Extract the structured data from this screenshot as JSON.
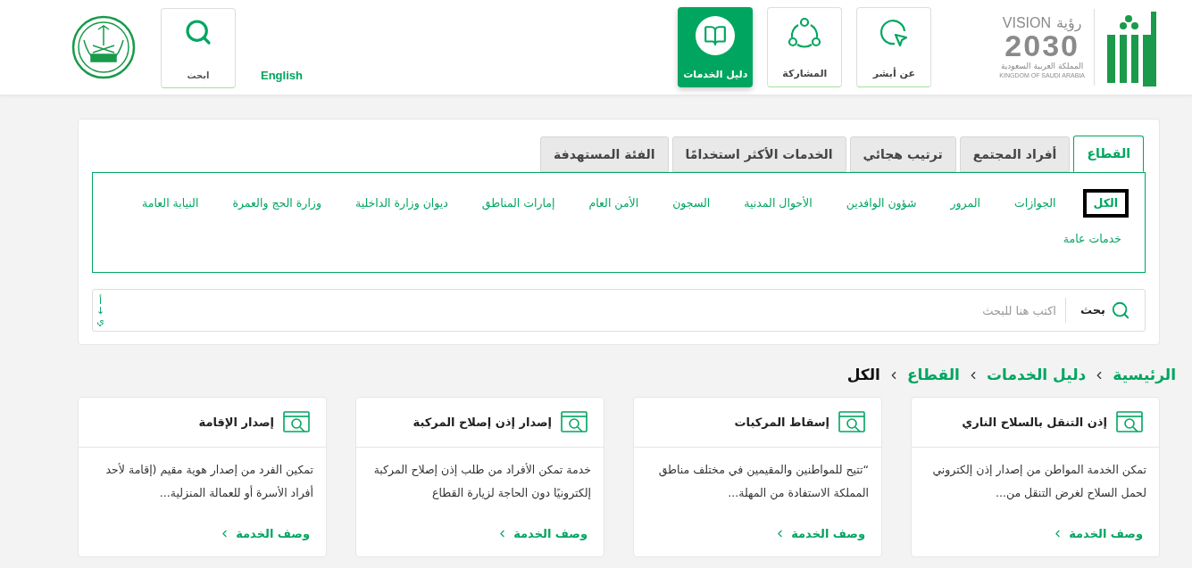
{
  "header": {
    "logo": {
      "vision": "VISION",
      "vision_ar": "رؤية",
      "year": "2030",
      "country_ar": "المملكة العربية السعودية",
      "country_en": "KINGDOM OF SAUDI ARABIA"
    },
    "nav": [
      {
        "label": "عن أبشر",
        "selected": false,
        "kind": "pointer"
      },
      {
        "label": "المشاركة",
        "selected": false,
        "kind": "share"
      },
      {
        "label": "دليل الخدمات",
        "selected": true,
        "kind": "book"
      }
    ],
    "language": "English",
    "search_label": "ابحث"
  },
  "tabs": [
    {
      "label": "القطاع",
      "selected": true
    },
    {
      "label": "أفراد المجتمع",
      "selected": false
    },
    {
      "label": "ترتيب هجائي",
      "selected": false
    },
    {
      "label": "الخدمات الأكثر استخدامًا",
      "selected": false
    },
    {
      "label": "الفئة المستهدفة",
      "selected": false
    }
  ],
  "sectors": [
    {
      "label": "الكل",
      "selected": true
    },
    {
      "label": "الجوازات",
      "selected": false
    },
    {
      "label": "المرور",
      "selected": false
    },
    {
      "label": "شؤون الوافدين",
      "selected": false
    },
    {
      "label": "الأحوال المدنية",
      "selected": false
    },
    {
      "label": "السجون",
      "selected": false
    },
    {
      "label": "الأمن العام",
      "selected": false
    },
    {
      "label": "إمارات المناطق",
      "selected": false
    },
    {
      "label": "ديوان وزارة الداخلية",
      "selected": false
    },
    {
      "label": "وزارة الحج والعمرة",
      "selected": false
    },
    {
      "label": "النيابة العامة",
      "selected": false
    },
    {
      "label": "خدمات عامة",
      "selected": false
    }
  ],
  "search": {
    "label": "بحث",
    "placeholder": "اكتب هنا للبحث",
    "sort": [
      "أ",
      "↓",
      "ي"
    ]
  },
  "breadcrumb": [
    {
      "label": "الرئيسية",
      "current": false
    },
    {
      "label": "دليل الخدمات",
      "current": false
    },
    {
      "label": "القطاع",
      "current": false
    },
    {
      "label": "الكل",
      "current": true
    }
  ],
  "cards": [
    {
      "title": "إذن التنقل بالسلاح الناري",
      "description": "تمكن الخدمة المواطن من إصدار إذن إلكتروني لحمل السلاح لغرض التنقل من...",
      "link": "وصف الخدمة"
    },
    {
      "title": "إسقاط المركبات",
      "description": "“تتيح للمواطنين والمقيمين في مختلف مناطق المملكة الاستفادة من المهلة...",
      "link": "وصف الخدمة"
    },
    {
      "title": "إصدار إذن إصلاح المركبة",
      "description": "خدمة تمكن الأفراد من طلب إذن إصلاح المركبة إلكترونيًا دون الحاجة لزيارة القطاع",
      "link": "وصف الخدمة"
    },
    {
      "title": "إصدار الإقامة",
      "description": "تمكين الفرد من إصدار هوية مقيم (إقامة لأحد أفراد الأسرة أو للعمالة المنزلية...",
      "link": "وصف الخدمة"
    }
  ]
}
